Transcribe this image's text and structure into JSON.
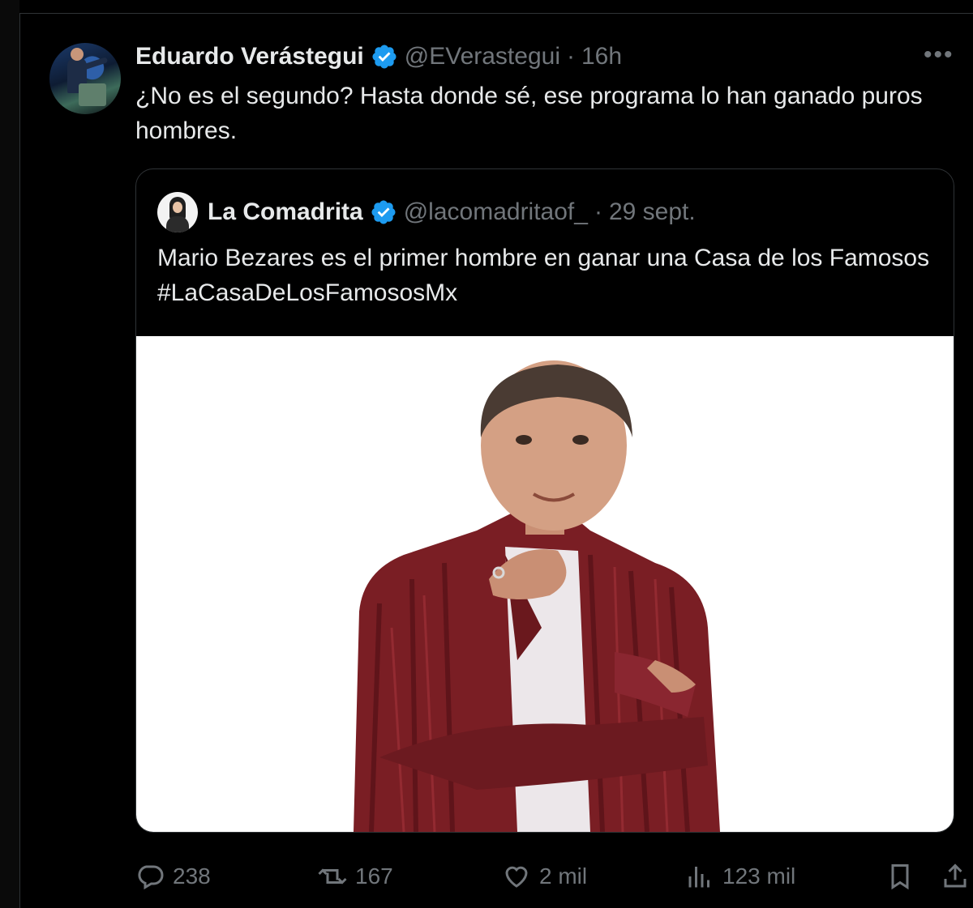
{
  "post": {
    "author_name": "Eduardo Verástegui",
    "author_handle": "@EVerastegui",
    "separator": "·",
    "time": "16h",
    "more_label": "•••",
    "text": "¿No es el segundo? Hasta donde sé, ese programa lo han ganado puros hombres."
  },
  "quoted": {
    "author_name": "La Comadrita",
    "author_handle": "@lacomadritaof_",
    "separator": "·",
    "date": "29 sept.",
    "text": "Mario Bezares es el primer hombre en ganar una Casa de los Famosos  #LaCasaDeLosFamososMx"
  },
  "actions": {
    "replies": "238",
    "reposts": "167",
    "likes": "2 mil",
    "views": "123 mil"
  },
  "colors": {
    "background": "#000000",
    "text_primary": "#e7e9ea",
    "text_secondary": "#71767b",
    "border": "#2f3336",
    "verified_blue": "#1d9bf0"
  },
  "icons": [
    "reply-icon",
    "repost-icon",
    "like-icon",
    "views-icon",
    "bookmark-icon",
    "share-icon",
    "verified-badge-icon",
    "more-icon"
  ]
}
